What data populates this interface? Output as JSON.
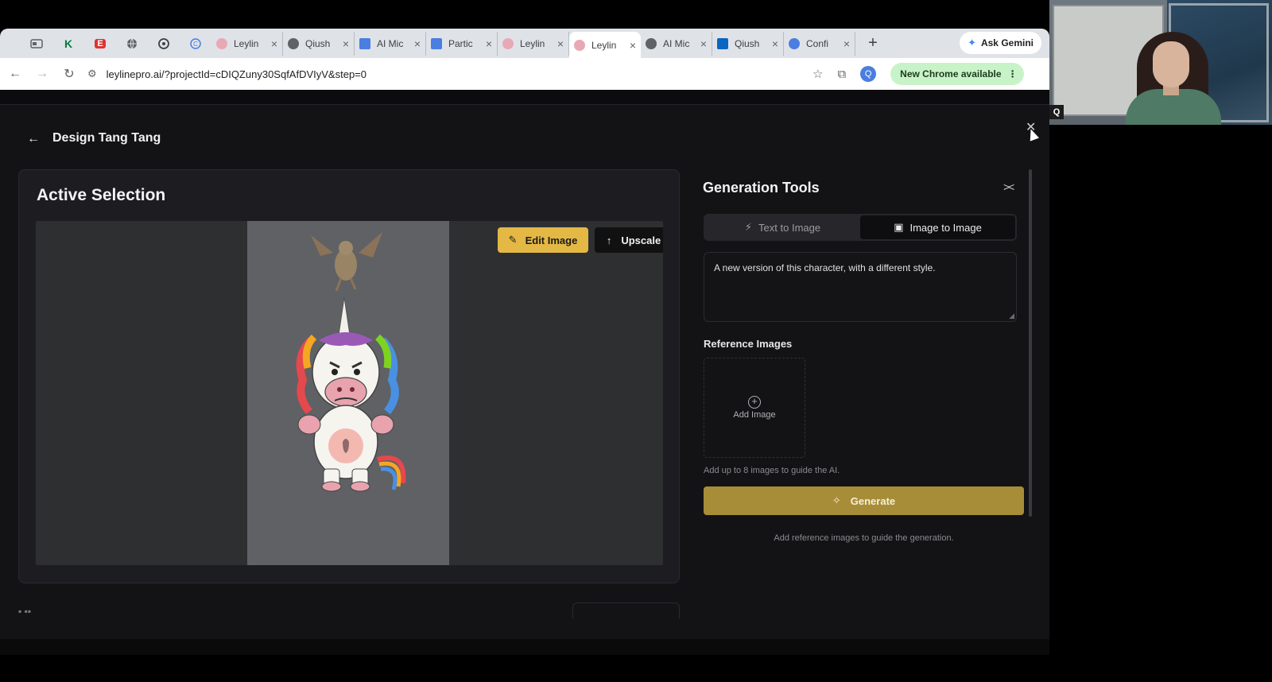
{
  "browser": {
    "tabs": [
      {
        "title": "Leylin",
        "favicon_color": "#e8a9b5"
      },
      {
        "title": "Qiush",
        "favicon_color": "#5f6368"
      },
      {
        "title": "AI Mic",
        "favicon_color": "#4a7ee0"
      },
      {
        "title": "Partic",
        "favicon_color": "#4a7ee0"
      },
      {
        "title": "Leylin",
        "favicon_color": "#e8a9b5"
      },
      {
        "title": "Leylin",
        "favicon_color": "#e8a9b5",
        "active": true
      },
      {
        "title": "AI Mic",
        "favicon_color": "#5f6368"
      },
      {
        "title": "Qiush",
        "favicon_color": "#0a66c2"
      },
      {
        "title": "Confi",
        "favicon_color": "#4a7ee0"
      }
    ],
    "new_tab": "+",
    "gemini_label": "Ask Gemini",
    "url": "leylinepro.ai/?projectId=cDIQZuny30SqfAfDVIyV&step=0",
    "update_label": "New Chrome available",
    "profile_initial": "Q"
  },
  "app": {
    "design_title": "Design Tang Tang",
    "active_selection": {
      "title": "Active Selection",
      "edit_label": "Edit Image",
      "upscale_label": "Upscale"
    },
    "generation_tools": {
      "title": "Generation Tools",
      "tabs": [
        {
          "label": "Text to Image",
          "active": false
        },
        {
          "label": "Image to Image",
          "active": true
        }
      ],
      "prompt_value": "A new version of this character, with a different style.",
      "reference_label": "Reference Images",
      "add_image_label": "Add Image",
      "helper_text": "Add up to 8 images to guide the AI.",
      "generate_label": "Generate",
      "generate_hint": "Add reference images to guide the generation."
    },
    "accent_color": "#e4b844"
  },
  "webcam": {
    "badge": "Q"
  }
}
